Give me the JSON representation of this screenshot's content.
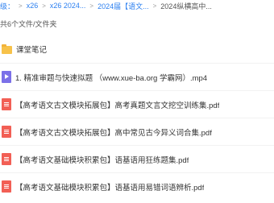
{
  "breadcrumb": [
    {
      "label": "级："
    },
    {
      "label": "x26"
    },
    {
      "label": "x26 2024..."
    },
    {
      "label": "2024届【语文..."
    },
    {
      "label": "2024纵横高中..."
    }
  ],
  "file_count_text": "共6个文件/文件夹",
  "files": [
    {
      "type": "folder",
      "icon": "folder-icon",
      "name": "课堂笔记"
    },
    {
      "type": "video",
      "icon": "video-file-icon",
      "name": "1. 精准审题与快速拟题 （www.xue-ba.org 学霸网）.mp4"
    },
    {
      "type": "pdf",
      "icon": "pdf-file-icon",
      "name": "【高考语文古文模块拓展包】高考真题文言文挖空训练集.pdf"
    },
    {
      "type": "pdf",
      "icon": "pdf-file-icon",
      "name": "【高考语文古文模块拓展包】高中常见古今异义词合集.pdf"
    },
    {
      "type": "pdf",
      "icon": "pdf-file-icon",
      "name": "【高考语文基础模块积累包】语基语用狂练题集.pdf"
    },
    {
      "type": "pdf",
      "icon": "pdf-file-icon",
      "name": "【高考语文基础模块积累包】语基语用易错词语辨析.pdf"
    }
  ],
  "colors": {
    "link": "#2b7ff0",
    "folder": "#f7c24a",
    "video": "#7b70e8",
    "pdf": "#f25f55"
  }
}
